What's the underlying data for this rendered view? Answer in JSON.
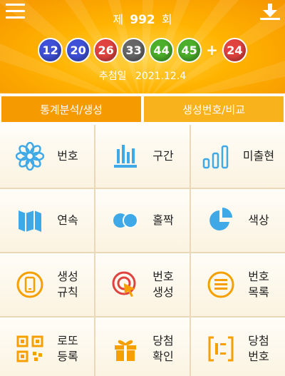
{
  "header": {
    "draw_prefix": "제",
    "draw_number": "992",
    "draw_suffix": "회",
    "balls": [
      {
        "number": "12",
        "color": "#3f51d8"
      },
      {
        "number": "20",
        "color": "#3f51d8"
      },
      {
        "number": "26",
        "color": "#e0433f"
      },
      {
        "number": "33",
        "color": "#666666"
      },
      {
        "number": "44",
        "color": "#4caf2a"
      },
      {
        "number": "45",
        "color": "#4caf2a"
      }
    ],
    "plus": "+",
    "bonus_ball": {
      "number": "24",
      "color": "#e0433f"
    },
    "date_label": "추첨일",
    "date_value": "2021.12.4",
    "menu_icon": "hamburger-menu-icon",
    "download_icon": "download-icon"
  },
  "tabs": [
    {
      "label": "통계분석/생성",
      "active": true
    },
    {
      "label": "생성번호/비교",
      "active": false
    }
  ],
  "menu": [
    {
      "lines": [
        "번호"
      ],
      "icon": "flower-icon"
    },
    {
      "lines": [
        "구간"
      ],
      "icon": "bar-chart-icon"
    },
    {
      "lines": [
        "미출현"
      ],
      "icon": "signal-bars-icon"
    },
    {
      "lines": [
        "연속"
      ],
      "icon": "map-icon"
    },
    {
      "lines": [
        "홀짝"
      ],
      "icon": "toggle-circles-icon"
    },
    {
      "lines": [
        "색상"
      ],
      "icon": "pie-chart-icon"
    },
    {
      "lines": [
        "생성",
        "규칙"
      ],
      "icon": "phone-rules-icon"
    },
    {
      "lines": [
        "번호",
        "생성"
      ],
      "icon": "target-click-icon"
    },
    {
      "lines": [
        "번호",
        "목록"
      ],
      "icon": "list-doc-icon"
    },
    {
      "lines": [
        "로또",
        "등록"
      ],
      "icon": "qr-code-icon"
    },
    {
      "lines": [
        "당첨",
        "확인"
      ],
      "icon": "gift-icon"
    },
    {
      "lines": [
        "당첨",
        "번호"
      ],
      "icon": "bracket-numbers-icon"
    }
  ],
  "colors": {
    "header_orange": "#f59500",
    "tab_active": "#f59a00",
    "icon_blue": "#3fa9e8",
    "icon_orange": "#f5a000",
    "icon_red": "#e0433f"
  }
}
